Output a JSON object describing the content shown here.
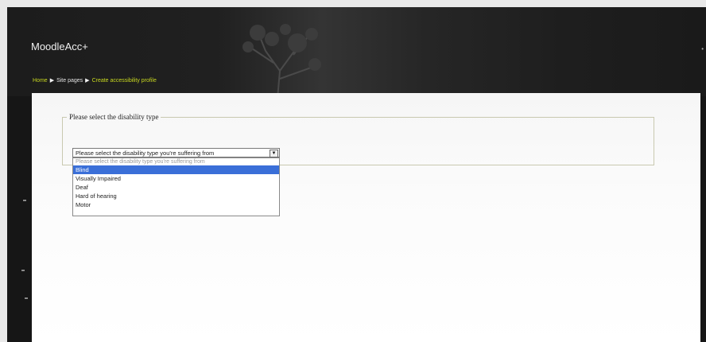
{
  "site": {
    "name": "MoodleAcc+"
  },
  "breadcrumb": [
    {
      "label": "Home",
      "link": true
    },
    {
      "label": "Site pages",
      "link": false
    },
    {
      "label": "Create accessibility profile",
      "link": true
    }
  ],
  "form": {
    "legend": "Please select the disability type",
    "select_value": "Please select the disability type you're suffering from",
    "options": [
      "Please select the disability type you're suffering from",
      "Blind",
      "Visually Impaired",
      "Deaf",
      "Hard of hearing",
      "Motor"
    ],
    "highlighted_option": "Blind"
  },
  "colors": {
    "breadcrumb_link": "#c8d820",
    "highlight": "#3a6fd8",
    "header_bg": "#1c1c1c"
  },
  "icons": {
    "breadcrumb_separator": "triangle-right-icon",
    "select_arrow": "chevron-down-icon"
  }
}
